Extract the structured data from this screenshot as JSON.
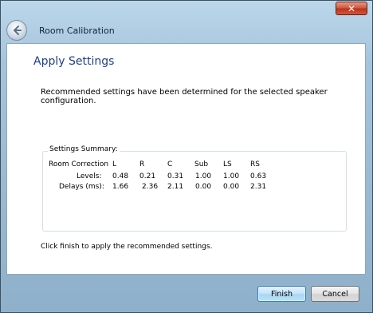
{
  "window": {
    "close_glyph": "✕",
    "accent_close": "#c9462b"
  },
  "nav": {
    "back_icon": "back-arrow-icon",
    "title": "Room Calibration"
  },
  "page": {
    "heading": "Apply Settings",
    "description": "Recommended settings have been determined for the selected speaker configuration.",
    "footer_text": "Click finish to apply the recommended settings."
  },
  "summary": {
    "group_label": "Settings Summary:",
    "header_label": "Room Correction",
    "channels": [
      "L",
      "R",
      "C",
      "Sub",
      "LS",
      "RS"
    ],
    "levels_label": "Levels:",
    "levels": [
      "0.48",
      "0.21",
      "0.31",
      "1.00",
      "1.00",
      "0.63"
    ],
    "delays_label": "Delays (ms):",
    "delays": [
      "1.66",
      "2.36",
      "2.11",
      "0.00",
      "0.00",
      "2.31"
    ]
  },
  "buttons": {
    "finish": "Finish",
    "cancel": "Cancel"
  }
}
